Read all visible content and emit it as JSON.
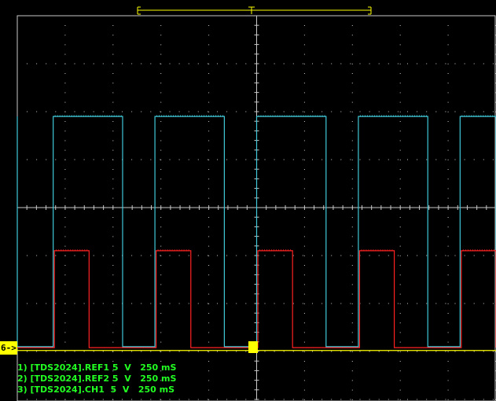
{
  "screen": {
    "background": "#000000",
    "grid_color": "#c8c8c8",
    "ground_marker_label": "6->",
    "ground_marker_color": "#ffff00",
    "trace_legend": [
      {
        "text": "1) [TDS2024].REF1 5  V   250 mS",
        "color": "#22ff22"
      },
      {
        "text": "2) [TDS2024].REF2 5  V   250 mS",
        "color": "#22ff22"
      },
      {
        "text": "3) [TDS2024].CH1  5  V   250 mS",
        "color": "#22ff22"
      }
    ]
  },
  "chart_data": {
    "type": "line",
    "title": "",
    "xlabel": "",
    "ylabel": "",
    "grid": true,
    "x_divisions": 10,
    "y_divisions": 8,
    "x_units": "div",
    "y_units": "div",
    "xlim": [
      0,
      10
    ],
    "ylim": [
      -4,
      4
    ],
    "series": [
      {
        "color": "#40c8d8",
        "low": -2.9,
        "high": 1.9,
        "period": 4.25,
        "high_intervals": [
          [
            -0.1,
            0.0
          ],
          [
            1.5,
            4.4
          ],
          [
            5.75,
            8.65
          ],
          [
            10.0,
            12.9
          ],
          [
            14.25,
            17.15
          ],
          [
            18.5,
            20.0
          ]
        ]
      },
      {
        "color": "#ff2222",
        "low": -2.92,
        "high": -0.9,
        "high_intervals": [
          [
            1.55,
            3.0
          ],
          [
            5.8,
            7.25
          ],
          [
            10.05,
            11.5
          ],
          [
            14.3,
            15.75
          ],
          [
            18.55,
            20.0
          ]
        ]
      },
      {
        "color": "#ffff00",
        "low": -2.98,
        "high": -2.98,
        "high_intervals": []
      }
    ]
  }
}
